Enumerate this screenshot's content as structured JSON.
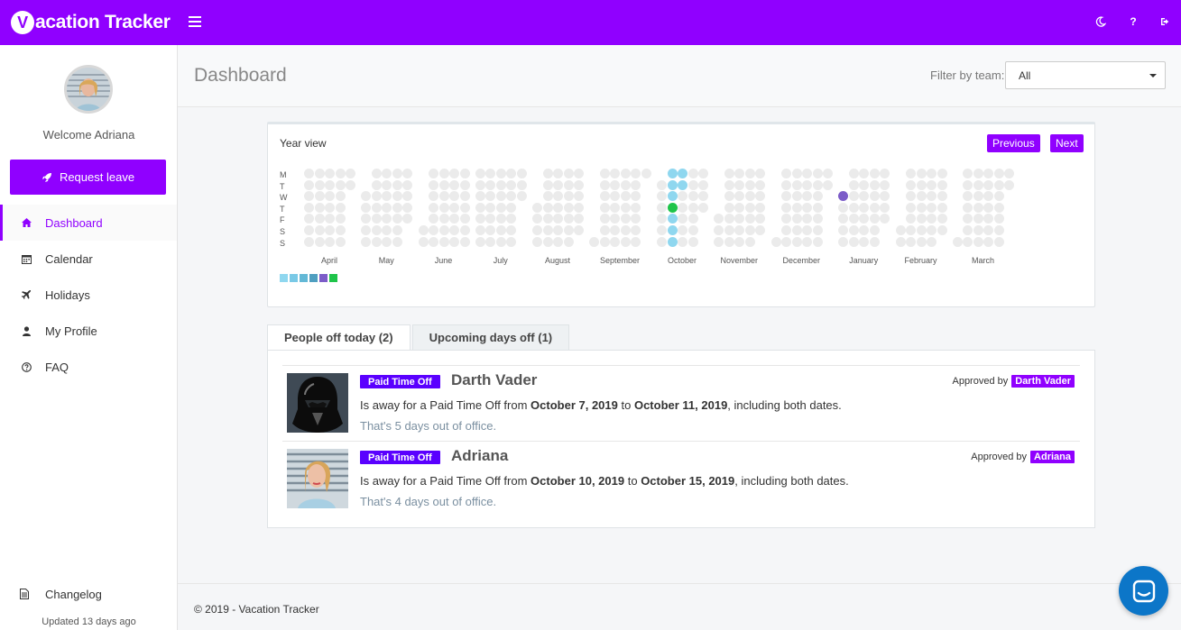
{
  "app": {
    "title": "Vacation Tracker",
    "logo_letter": "V",
    "logo_rest": "acation Tracker"
  },
  "topbar": {
    "icons": [
      "moon-icon",
      "question-icon",
      "sign-out-icon"
    ],
    "help_glyph": "?"
  },
  "sidebar": {
    "welcome": "Welcome Adriana",
    "request_leave": "Request leave",
    "items": [
      {
        "label": "Dashboard",
        "icon": "home-icon",
        "active": true
      },
      {
        "label": "Calendar",
        "icon": "calendar-icon",
        "active": false
      },
      {
        "label": "Holidays",
        "icon": "plane-icon",
        "active": false
      },
      {
        "label": "My Profile",
        "icon": "user-icon",
        "active": false
      },
      {
        "label": "FAQ",
        "icon": "question-circle-icon",
        "active": false
      }
    ],
    "changelog": "Changelog",
    "updated": "Updated 13 days ago"
  },
  "header": {
    "title": "Dashboard",
    "filter_label": "Filter by team:",
    "filter_value": "All"
  },
  "year_view": {
    "title": "Year view",
    "previous": "Previous",
    "next": "Next",
    "weekdays": [
      "M",
      "T",
      "W",
      "T",
      "F",
      "S",
      "S"
    ],
    "months": [
      "April",
      "May",
      "June",
      "July",
      "August",
      "September",
      "October",
      "November",
      "December",
      "January",
      "February",
      "March"
    ],
    "legend_colors": [
      "#8fd7ef",
      "#79c9e6",
      "#63b8d6",
      "#4f9fc0",
      "#7c5cc8",
      "#1fc44a"
    ],
    "colors": {
      "empty": "#ebebeb",
      "leave": "#8fd7ef",
      "today": "#1fc44a",
      "holiday": "#7c5cc8"
    }
  },
  "tabs": [
    {
      "label": "People off today (2)",
      "active": true
    },
    {
      "label": "Upcoming days off (1)",
      "active": false
    }
  ],
  "entries": [
    {
      "badge": "Paid Time Off",
      "name": "Darth Vader",
      "desc_prefix": "Is away for a Paid Time Off from ",
      "from": "October 7, 2019",
      "to_word": " to ",
      "to": "October 11, 2019",
      "desc_suffix": ", including both dates.",
      "days": "That's 5 days out of office.",
      "approved_label": "Approved by",
      "approver": "Darth Vader"
    },
    {
      "badge": "Paid Time Off",
      "name": "Adriana",
      "desc_prefix": "Is away for a Paid Time Off from ",
      "from": "October 10, 2019",
      "to_word": " to ",
      "to": "October 15, 2019",
      "desc_suffix": ", including both dates.",
      "days": "That's 4 days out of office.",
      "approved_label": "Approved by",
      "approver": "Adriana"
    }
  ],
  "footer": {
    "text": "© 2019 - Vacation Tracker"
  },
  "brand": {
    "accent": "#9000ff",
    "badge": "#5a00ff",
    "chat": "#0c76c8"
  }
}
